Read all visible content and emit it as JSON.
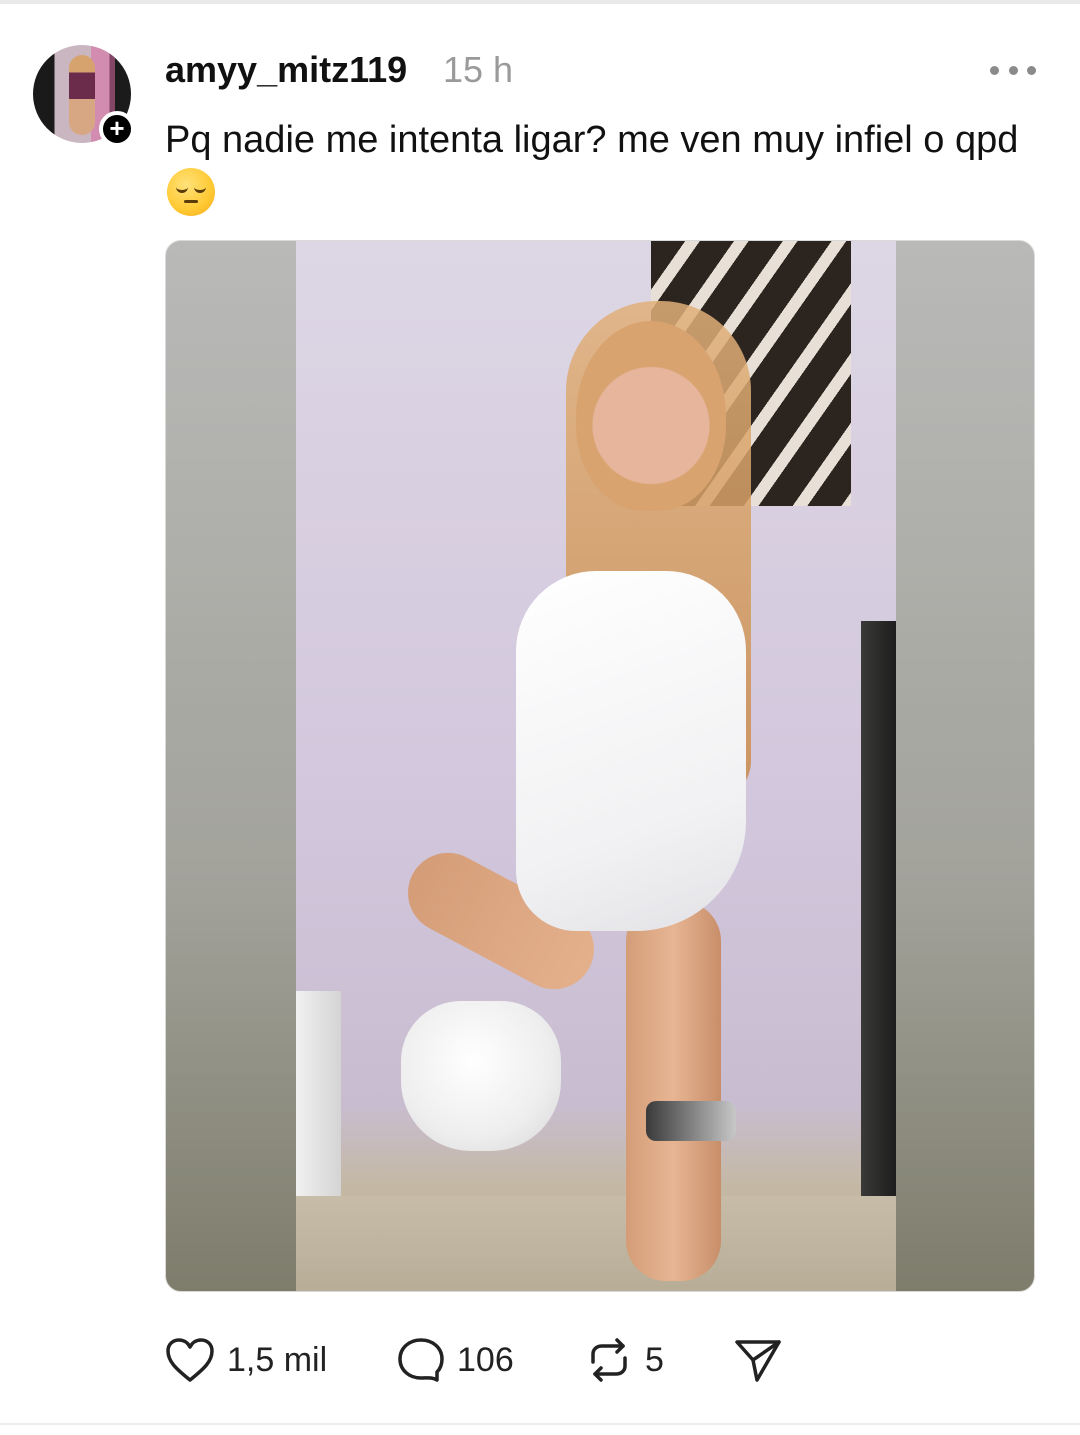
{
  "post": {
    "username": "amyy_mitz119",
    "timestamp": "15 h",
    "caption": "Pq nadie me intenta ligar? me ven muy infiel o qpd",
    "caption_emoji": "pensive-face"
  },
  "actions": {
    "likes": "1,5 mil",
    "replies": "106",
    "reposts": "5"
  },
  "icons": {
    "follow": "plus-icon",
    "more": "more-icon",
    "like": "heart-icon",
    "reply": "comment-icon",
    "repost": "repost-icon",
    "share": "send-icon"
  },
  "colors": {
    "text": "#111111",
    "muted": "#9a9a9a",
    "background": "#ffffff"
  }
}
